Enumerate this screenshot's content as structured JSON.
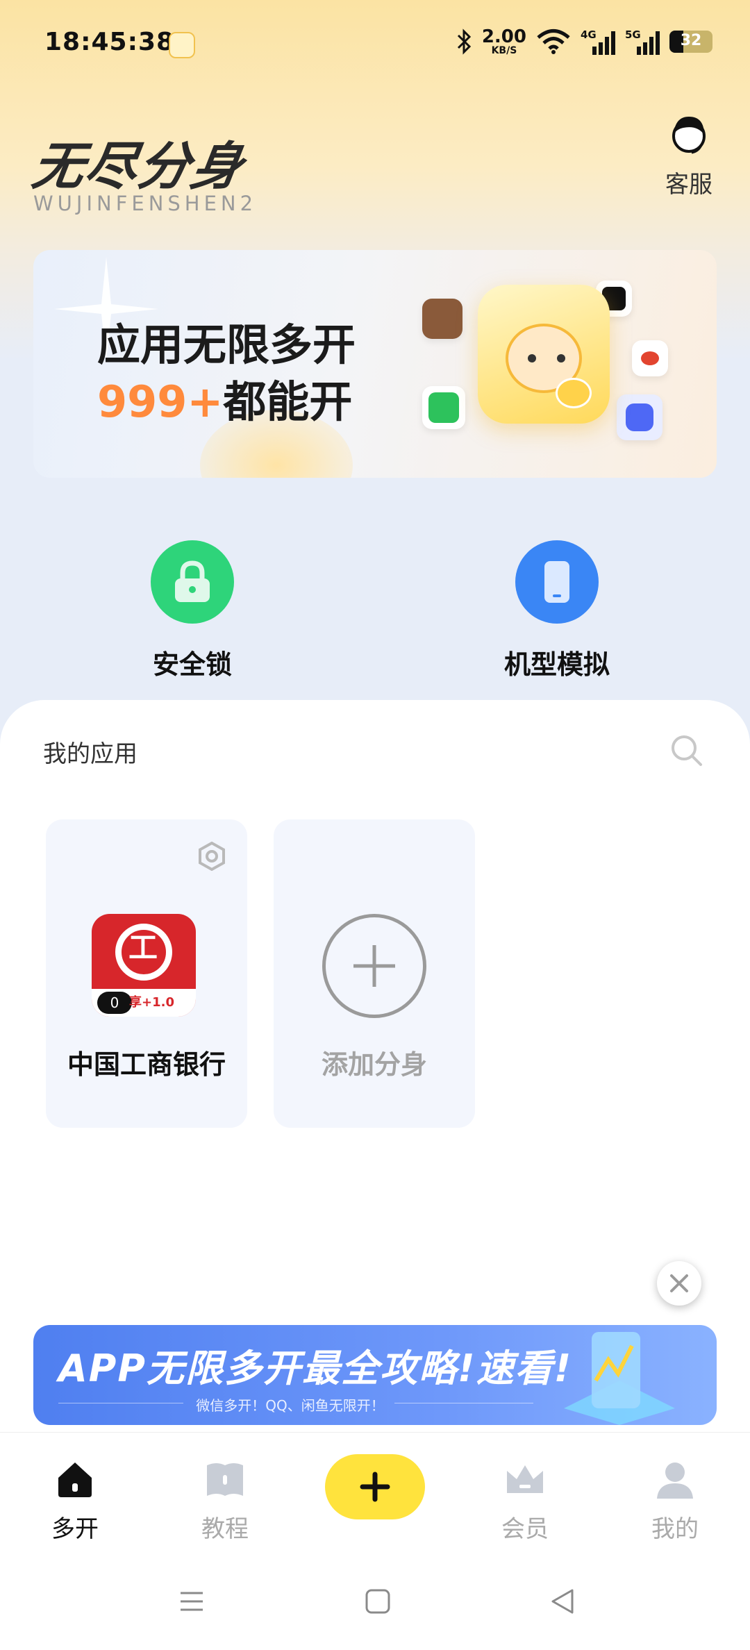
{
  "status_bar": {
    "time": "18:45:38",
    "speed_value": "2.00",
    "speed_unit": "KB/S",
    "signal_1": "4G",
    "signal_2": "5G",
    "battery": "32"
  },
  "header": {
    "logo_text": "无尽分身",
    "logo_sub": "WUJINFENSHEN2",
    "service_label": "客服"
  },
  "banner": {
    "line1": "应用无限多开",
    "line2_num": "999+",
    "line2_text": "都能开"
  },
  "tools": [
    {
      "label": "安全锁",
      "icon": "lock-icon",
      "color": "#2ed47a"
    },
    {
      "label": "机型模拟",
      "icon": "phone-icon",
      "color": "#3a86f5"
    }
  ],
  "apps": {
    "title": "我的应用",
    "items": [
      {
        "name": "中国工商银行",
        "badge_count": "0",
        "badge_text": "享+1.0"
      },
      {
        "name": "添加分身"
      }
    ]
  },
  "promo": {
    "title": "APP无限多开最全攻略!速看!",
    "subtitle": "微信多开！QQ、闲鱼无限开！"
  },
  "tabs": [
    {
      "label": "多开",
      "icon": "home-icon",
      "active": true
    },
    {
      "label": "教程",
      "icon": "book-icon",
      "active": false
    },
    {
      "label": "会员",
      "icon": "crown-icon",
      "active": false
    },
    {
      "label": "我的",
      "icon": "user-icon",
      "active": false
    }
  ],
  "colors": {
    "accent": "#ffe33d",
    "banner_num": "#ff8a3c"
  }
}
